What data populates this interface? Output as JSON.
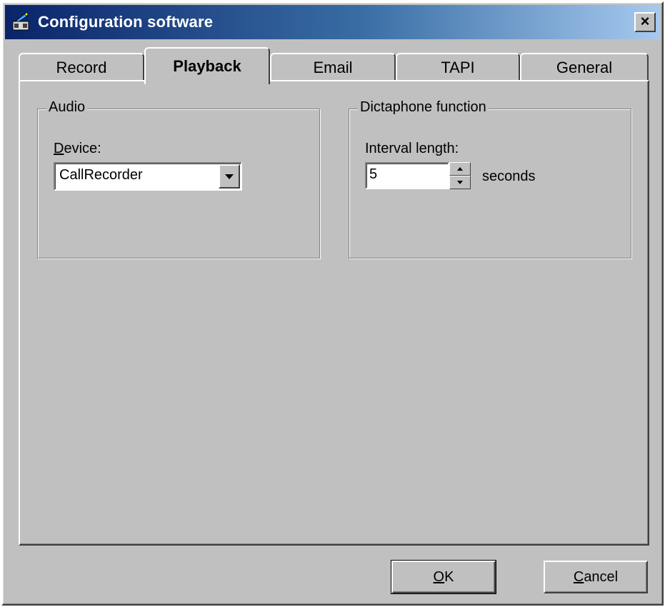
{
  "window": {
    "title": "Configuration software",
    "close_glyph": "×",
    "icon": "tape-recorder-icon"
  },
  "tabs": [
    {
      "label": "Record",
      "active": false
    },
    {
      "label": "Playback",
      "active": true
    },
    {
      "label": "Email",
      "active": false
    },
    {
      "label": "TAPI",
      "active": false
    },
    {
      "label": "General",
      "active": false
    }
  ],
  "audio_group": {
    "title": "Audio",
    "device_label_mnemonic": "D",
    "device_label_rest": "evice:",
    "device_value": "CallRecorder"
  },
  "dictaphone_group": {
    "title": "Dictaphone function",
    "interval_label": "Interval length:",
    "interval_value": "5",
    "unit_label": "seconds"
  },
  "buttons": {
    "ok_mnemonic": "O",
    "ok_rest": "K",
    "cancel_mnemonic": "C",
    "cancel_rest": "ancel"
  },
  "colors": {
    "titlebar_start": "#0a246a",
    "titlebar_end": "#a6caf0",
    "face": "#c0c0c0"
  }
}
